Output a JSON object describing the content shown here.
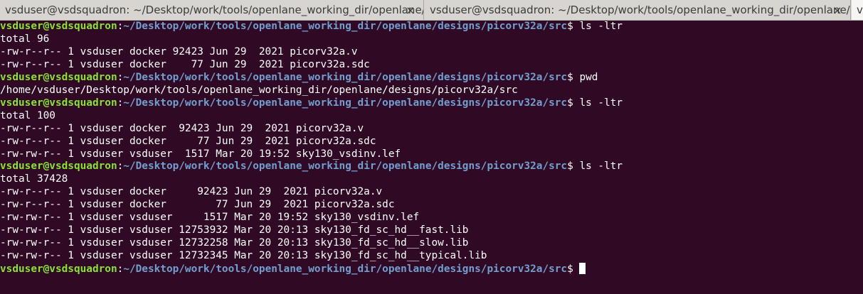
{
  "tabs": [
    {
      "title": "vsduser@vsdsquadron: ~/Desktop/work/tools/openlane_working_dir/openlane/...",
      "close": "×"
    },
    {
      "title": "vsduser@vsdsquadron: ~/Desktop/work/tools/openlane_working_dir/openlane/...",
      "close": "×"
    },
    {
      "title": "v"
    }
  ],
  "prompt": {
    "user": "vsduser@vsdsquadron",
    "sep": ":",
    "path": "~/Desktop/work/tools/openlane_working_dir/openlane/designs/picorv32a/src",
    "dollar": "$"
  },
  "lines": [
    {
      "type": "prompt",
      "cmd": " ls -ltr"
    },
    {
      "type": "out",
      "text": "total 96"
    },
    {
      "type": "out",
      "text": "-rw-r--r-- 1 vsduser docker 92423 Jun 29  2021 picorv32a.v"
    },
    {
      "type": "out",
      "text": "-rw-r--r-- 1 vsduser docker    77 Jun 29  2021 picorv32a.sdc"
    },
    {
      "type": "prompt",
      "cmd": " pwd"
    },
    {
      "type": "out",
      "text": "/home/vsduser/Desktop/work/tools/openlane_working_dir/openlane/designs/picorv32a/src"
    },
    {
      "type": "prompt",
      "cmd": " ls -ltr"
    },
    {
      "type": "out",
      "text": "total 100"
    },
    {
      "type": "out",
      "text": "-rw-r--r-- 1 vsduser docker  92423 Jun 29  2021 picorv32a.v"
    },
    {
      "type": "out",
      "text": "-rw-r--r-- 1 vsduser docker     77 Jun 29  2021 picorv32a.sdc"
    },
    {
      "type": "out",
      "text": "-rw-rw-r-- 1 vsduser vsduser  1517 Mar 20 19:52 sky130_vsdinv.lef"
    },
    {
      "type": "prompt",
      "cmd": " ls -ltr"
    },
    {
      "type": "out",
      "text": "total 37428"
    },
    {
      "type": "out",
      "text": "-rw-r--r-- 1 vsduser docker     92423 Jun 29  2021 picorv32a.v"
    },
    {
      "type": "out",
      "text": "-rw-r--r-- 1 vsduser docker        77 Jun 29  2021 picorv32a.sdc"
    },
    {
      "type": "out",
      "text": "-rw-rw-r-- 1 vsduser vsduser     1517 Mar 20 19:52 sky130_vsdinv.lef"
    },
    {
      "type": "out",
      "text": "-rw-rw-r-- 1 vsduser vsduser 12753932 Mar 20 20:13 sky130_fd_sc_hd__fast.lib"
    },
    {
      "type": "out",
      "text": "-rw-rw-r-- 1 vsduser vsduser 12732258 Mar 20 20:13 sky130_fd_sc_hd__slow.lib"
    },
    {
      "type": "out",
      "text": "-rw-rw-r-- 1 vsduser vsduser 12732345 Mar 20 20:13 sky130_fd_sc_hd__typical.lib"
    },
    {
      "type": "prompt",
      "cmd": " ",
      "cursor": true
    }
  ],
  "colors": {
    "background": "#300a24",
    "user": "#8ae234",
    "path": "#729fcf",
    "text": "#ffffff"
  }
}
